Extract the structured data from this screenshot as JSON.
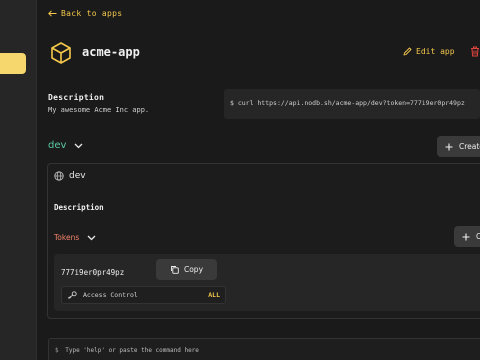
{
  "nav": {
    "back_label": "Back to apps"
  },
  "app": {
    "name": "acme-app",
    "edit_label": "Edit app",
    "description_label": "Description",
    "description": "My awesome Acme Inc app.",
    "curl_command": "$ curl https://api.nodb.sh/acme-app/dev?token=777i9er0pr49pz"
  },
  "environment": {
    "selected": "dev",
    "create_label": "Create",
    "card": {
      "name": "dev",
      "description_label": "Description",
      "tokens_label": "Tokens",
      "add_token_label": "C",
      "tokens": [
        {
          "value": "777i9er0pr49pz",
          "copy_label": "Copy",
          "access_label": "Access Control",
          "access_value": "ALL"
        }
      ]
    }
  },
  "command_bar": {
    "prompt": "$",
    "placeholder": "Type 'help' or paste the command here"
  },
  "colors": {
    "accent_yellow": "#f5c84c",
    "env_green": "#5cc9a7",
    "tokens_orange": "#f2836b",
    "danger_red": "#e0443e"
  }
}
